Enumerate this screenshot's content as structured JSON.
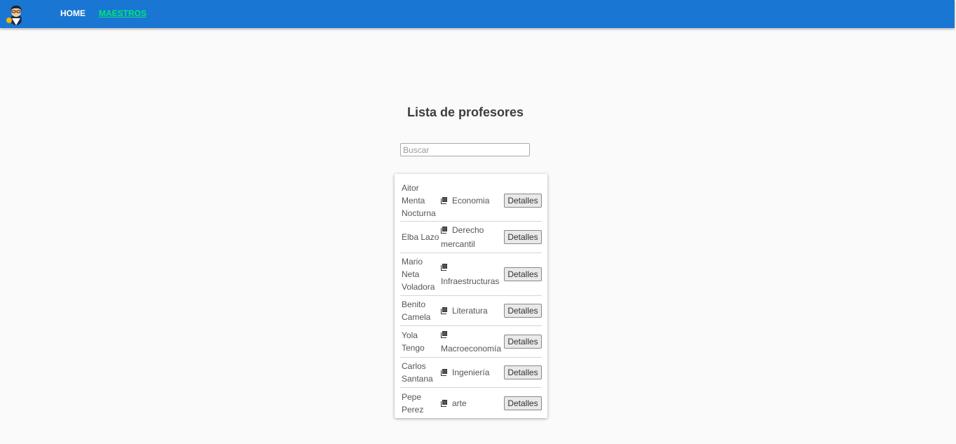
{
  "nav": {
    "home_label": "HOME",
    "maestros_label": "MAESTROS"
  },
  "main": {
    "title": "Lista de profesores",
    "search_placeholder": "Buscar",
    "search_value": ""
  },
  "teachers": [
    {
      "name": "Aitor Menta Nocturna",
      "subject": "Economia",
      "action": "Detalles"
    },
    {
      "name": "Elba Lazo",
      "subject": "Derecho mercantil",
      "action": "Detalles"
    },
    {
      "name": "Mario Neta Voladora",
      "subject": "Infraestructuras",
      "action": "Detalles"
    },
    {
      "name": "Benito Camela",
      "subject": "Literatura",
      "action": "Detalles"
    },
    {
      "name": "Yola Tengo",
      "subject": "Macroeconomía",
      "action": "Detalles"
    },
    {
      "name": "Carlos Santana",
      "subject": "Ingeniería",
      "action": "Detalles"
    },
    {
      "name": "Pepe Perez",
      "subject": "arte",
      "action": "Detalles"
    }
  ],
  "icons": {
    "logo": "teacher-avatar-icon",
    "subject": "book-icon"
  },
  "colors": {
    "navbar": "#1976d2",
    "active_nav": "#00e676",
    "background": "#fafafa"
  }
}
